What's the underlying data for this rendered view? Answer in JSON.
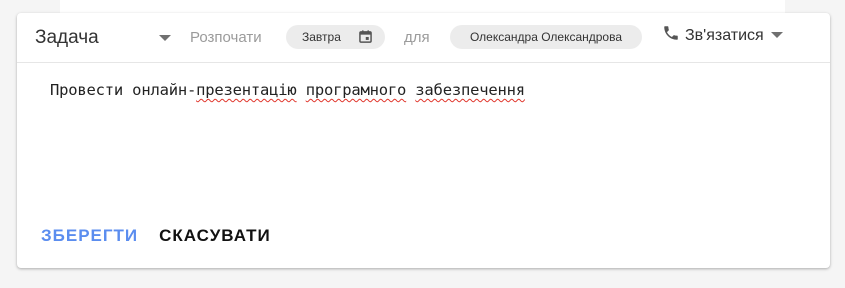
{
  "task_type": {
    "selected": "Задача"
  },
  "header": {
    "start_label": "Розпочати",
    "date_value": "Завтра",
    "for_label": "для",
    "assignee": "Олександра Олександрова",
    "contact_label": "Зв'язатися"
  },
  "task": {
    "segments": [
      {
        "text": "Провести онлайн-",
        "misspelled": false
      },
      {
        "text": "презентацію",
        "misspelled": true
      },
      {
        "text": " ",
        "misspelled": false
      },
      {
        "text": "програмного",
        "misspelled": true
      },
      {
        "text": " ",
        "misspelled": false
      },
      {
        "text": "забезпечення",
        "misspelled": true
      }
    ]
  },
  "actions": {
    "save_label": "Зберегти",
    "cancel_label": "Скасувати"
  },
  "colors": {
    "accent": "#5b8def",
    "chip_bg": "#ececec",
    "spell_error": "#e0352b"
  },
  "icons": {
    "type_dropdown": "caret-down-icon",
    "date": "calendar-icon",
    "contact": "phone-icon",
    "contact_dropdown": "caret-down-icon"
  }
}
